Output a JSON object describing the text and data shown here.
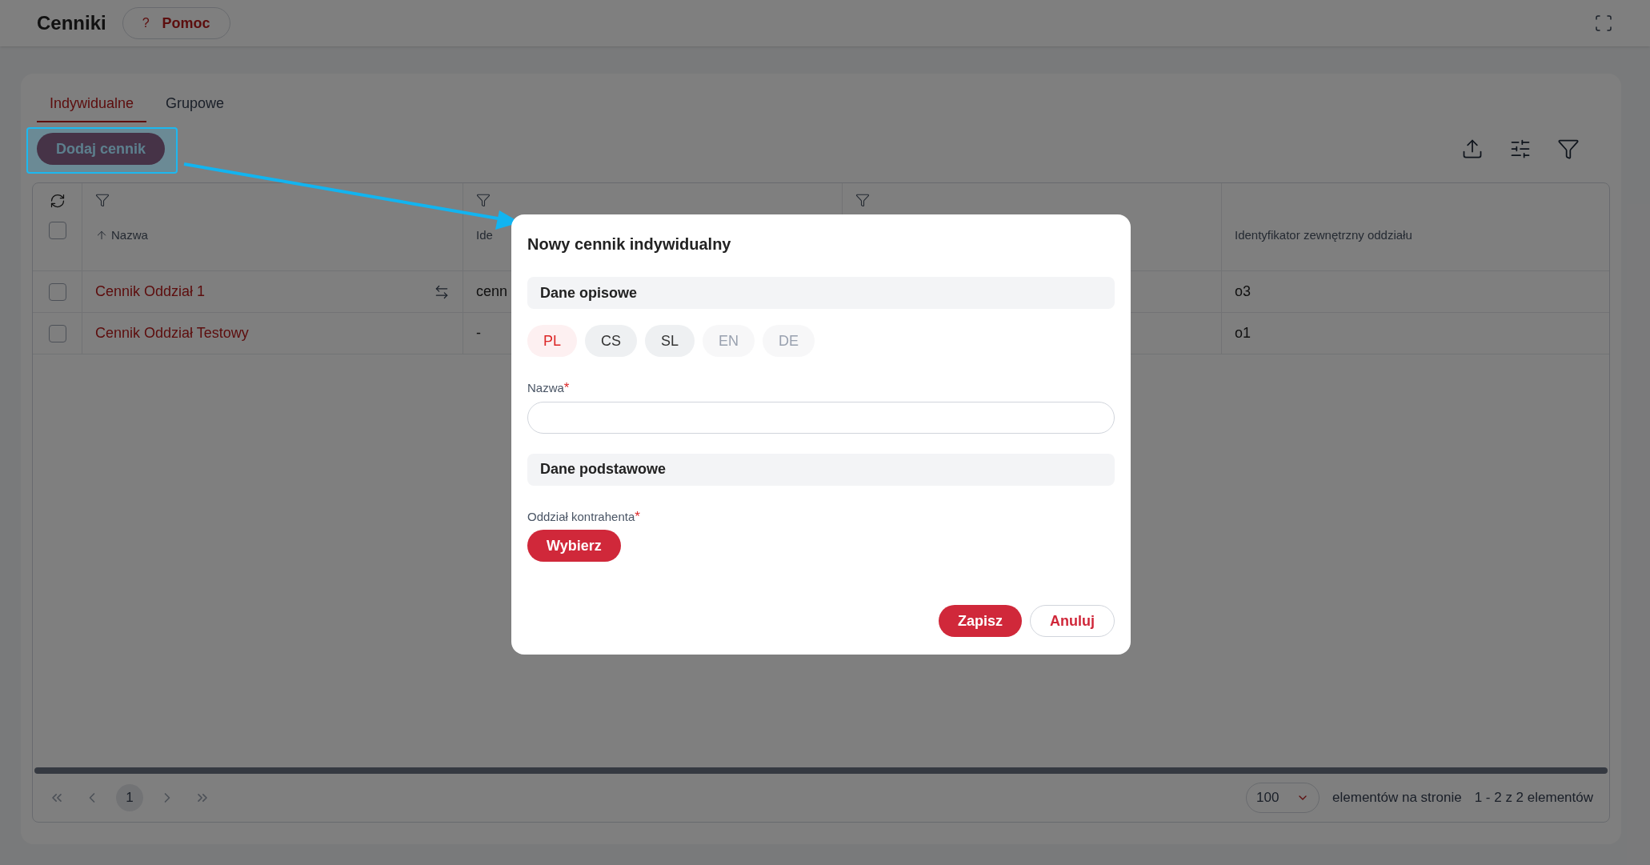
{
  "header": {
    "title": "Cenniki",
    "help_icon": "?",
    "help": "Pomoc"
  },
  "tabs": [
    {
      "label": "Indywidualne",
      "selected": true
    },
    {
      "label": "Grupowe",
      "selected": false
    }
  ],
  "add_button": "Dodaj cennik",
  "table": {
    "columns": [
      {
        "label": "Nazwa",
        "sorted": true,
        "filter": true
      },
      {
        "label": "Ide",
        "sorted": false,
        "filter": true
      },
      {
        "sorted": false,
        "filter": true
      },
      {
        "label": "Identyfikator zewnętrzny oddziału",
        "sorted": false,
        "filter": false
      }
    ],
    "all_checked": false,
    "rows": [
      {
        "checked": false,
        "name": "Cennik Oddział 1",
        "swap": true,
        "column_2": "cenn",
        "column_4": "o3"
      },
      {
        "checked": false,
        "name": "Cennik Oddział Testowy",
        "swap": false,
        "column_2": "-",
        "column_4": "o1"
      }
    ]
  },
  "pagination": {
    "page": "1",
    "per_page": "100",
    "per_page_label": "elementów na stronie",
    "range": "1 - 2 z 2 elementów"
  },
  "modal": {
    "title": "Nowy cennik indywidualny",
    "section_1": "Dane opisowe",
    "languages": [
      {
        "label": "PL",
        "selected": true,
        "filled": true
      },
      {
        "label": "CS",
        "selected": false,
        "filled": true
      },
      {
        "label": "SL",
        "selected": false,
        "filled": true
      },
      {
        "label": "EN",
        "selected": false,
        "filled": false
      },
      {
        "label": "DE",
        "selected": false,
        "filled": false
      }
    ],
    "name_label": "Nazwa",
    "required_mark": "*",
    "section_2": "Dane podstawowe",
    "branch_label": "Oddział kontrahenta",
    "choose_button": "Wybierz",
    "save_button": "Zapisz",
    "cancel_button": "Anuluj"
  }
}
